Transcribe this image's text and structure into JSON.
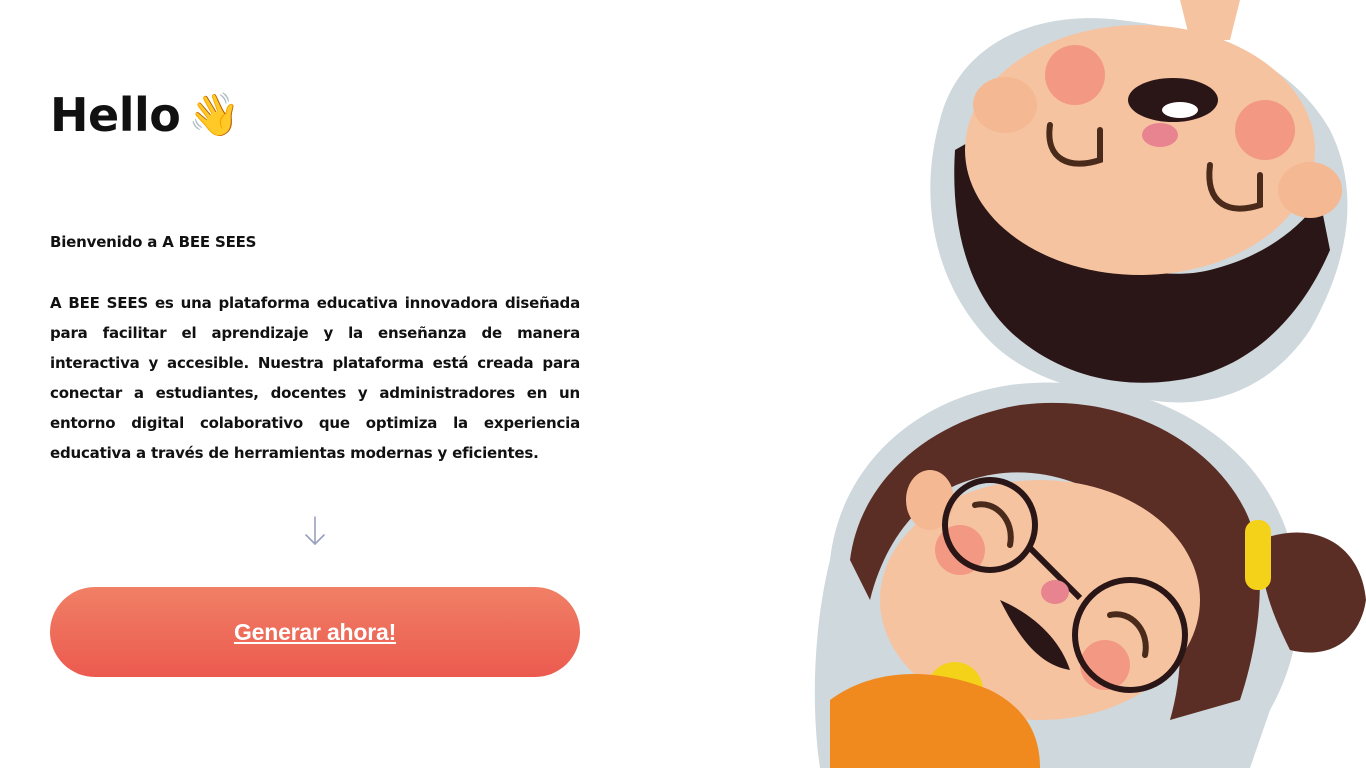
{
  "hero": {
    "greeting": "Hello",
    "wave_emoji": "👋",
    "welcome": "Bienvenido a A BEE SEES",
    "description": "A BEE SEES es una plataforma educativa innovadora diseñada para facilitar el aprendizaje y la enseñanza de manera interactiva y accesible. Nuestra plataforma está creada para conectar a estudiantes, docentes y administradores en un entorno digital colaborativo que optimiza la experiencia educativa a través de herramientas modernas y eficientes.",
    "arrow_icon": "arrow-down-icon"
  },
  "cta": {
    "label": "Generar ahora!"
  },
  "illustration": {
    "icon": "kids-illustration"
  },
  "colors": {
    "cta_top": "#f08066",
    "cta_bottom": "#ec5a4f",
    "text": "#111111",
    "arrow": "#9aa0c0"
  }
}
